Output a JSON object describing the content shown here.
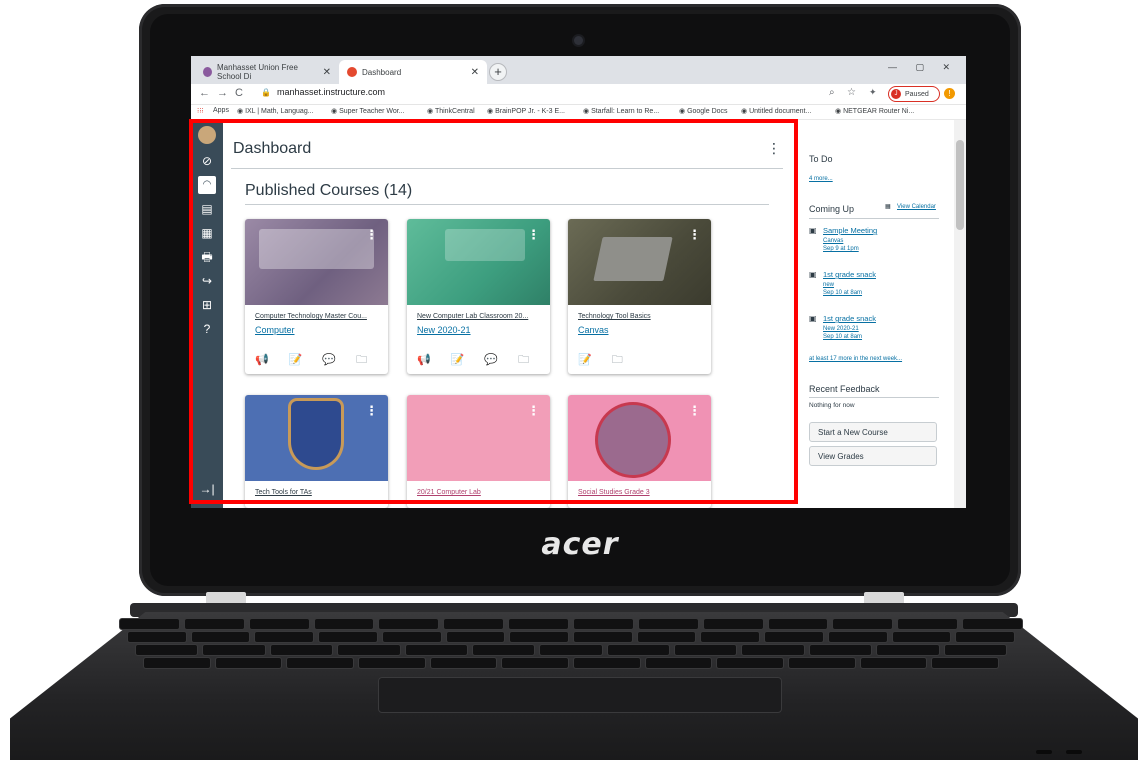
{
  "laptop": {
    "brand": "acer"
  },
  "browser": {
    "tabs": [
      {
        "label": "Manhasset Union Free School Di",
        "favicon_color": "#8a5a9e"
      },
      {
        "label": "Dashboard",
        "favicon_color": "#e4492f"
      }
    ],
    "new_tab": "+",
    "window_controls": "— ▢ ✕",
    "nav": {
      "back": "←",
      "forward": "→",
      "reload": "C"
    },
    "url": "manhasset.instructure.com",
    "profile": {
      "initial": "J",
      "status": "Paused"
    },
    "alert": "!",
    "bookmarks": [
      "Apps",
      "IXL | Math, Languag...",
      "Super Teacher Wor...",
      "ThinkCentral",
      "BrainPOP Jr. - K-3 E...",
      "Starfall: Learn to Re...",
      "Google Docs",
      "Untitled document...",
      "NETGEAR Router Ni..."
    ]
  },
  "canvas": {
    "page_title": "Dashboard",
    "section_title": "Published Courses (14)",
    "collapse_icon": "→|",
    "courses": [
      {
        "title": "Computer Technology Master Cou...",
        "code": "Computer",
        "color": "#7d6b8d"
      },
      {
        "title": "New Computer Lab Classroom 20...",
        "code": "New 2020-21",
        "color": "#3d9e7f"
      },
      {
        "title": "Technology Tool Basics",
        "code": "Canvas",
        "color": "#5a5a44"
      },
      {
        "title": "Tech Tools for TAs",
        "code": "",
        "color": "#4d6fb3"
      },
      {
        "title": "20/21 Computer Lab",
        "code": "",
        "color": "#f29eb8"
      },
      {
        "title": "Social Studies Grade 3",
        "code": "",
        "color": "#f092b4"
      }
    ],
    "sidebar": {
      "todo_title": "To Do",
      "todo_more": "4 more...",
      "coming_up_title": "Coming Up",
      "view_calendar": "View Calendar",
      "events": [
        {
          "title": "Sample Meeting",
          "course": "Canvas",
          "when": "Sep 9 at 1pm"
        },
        {
          "title": "1st grade snack",
          "course": "new",
          "when": "Sep 10 at 8am"
        },
        {
          "title": "1st grade snack",
          "course": "New 2020-21",
          "when": "Sep 10 at 8am"
        }
      ],
      "more_next_week": "at least 17 more in the next week...",
      "recent_feedback_title": "Recent Feedback",
      "nothing_for_now": "Nothing for now",
      "start_new_course": "Start a New Course",
      "view_grades": "View Grades"
    }
  }
}
